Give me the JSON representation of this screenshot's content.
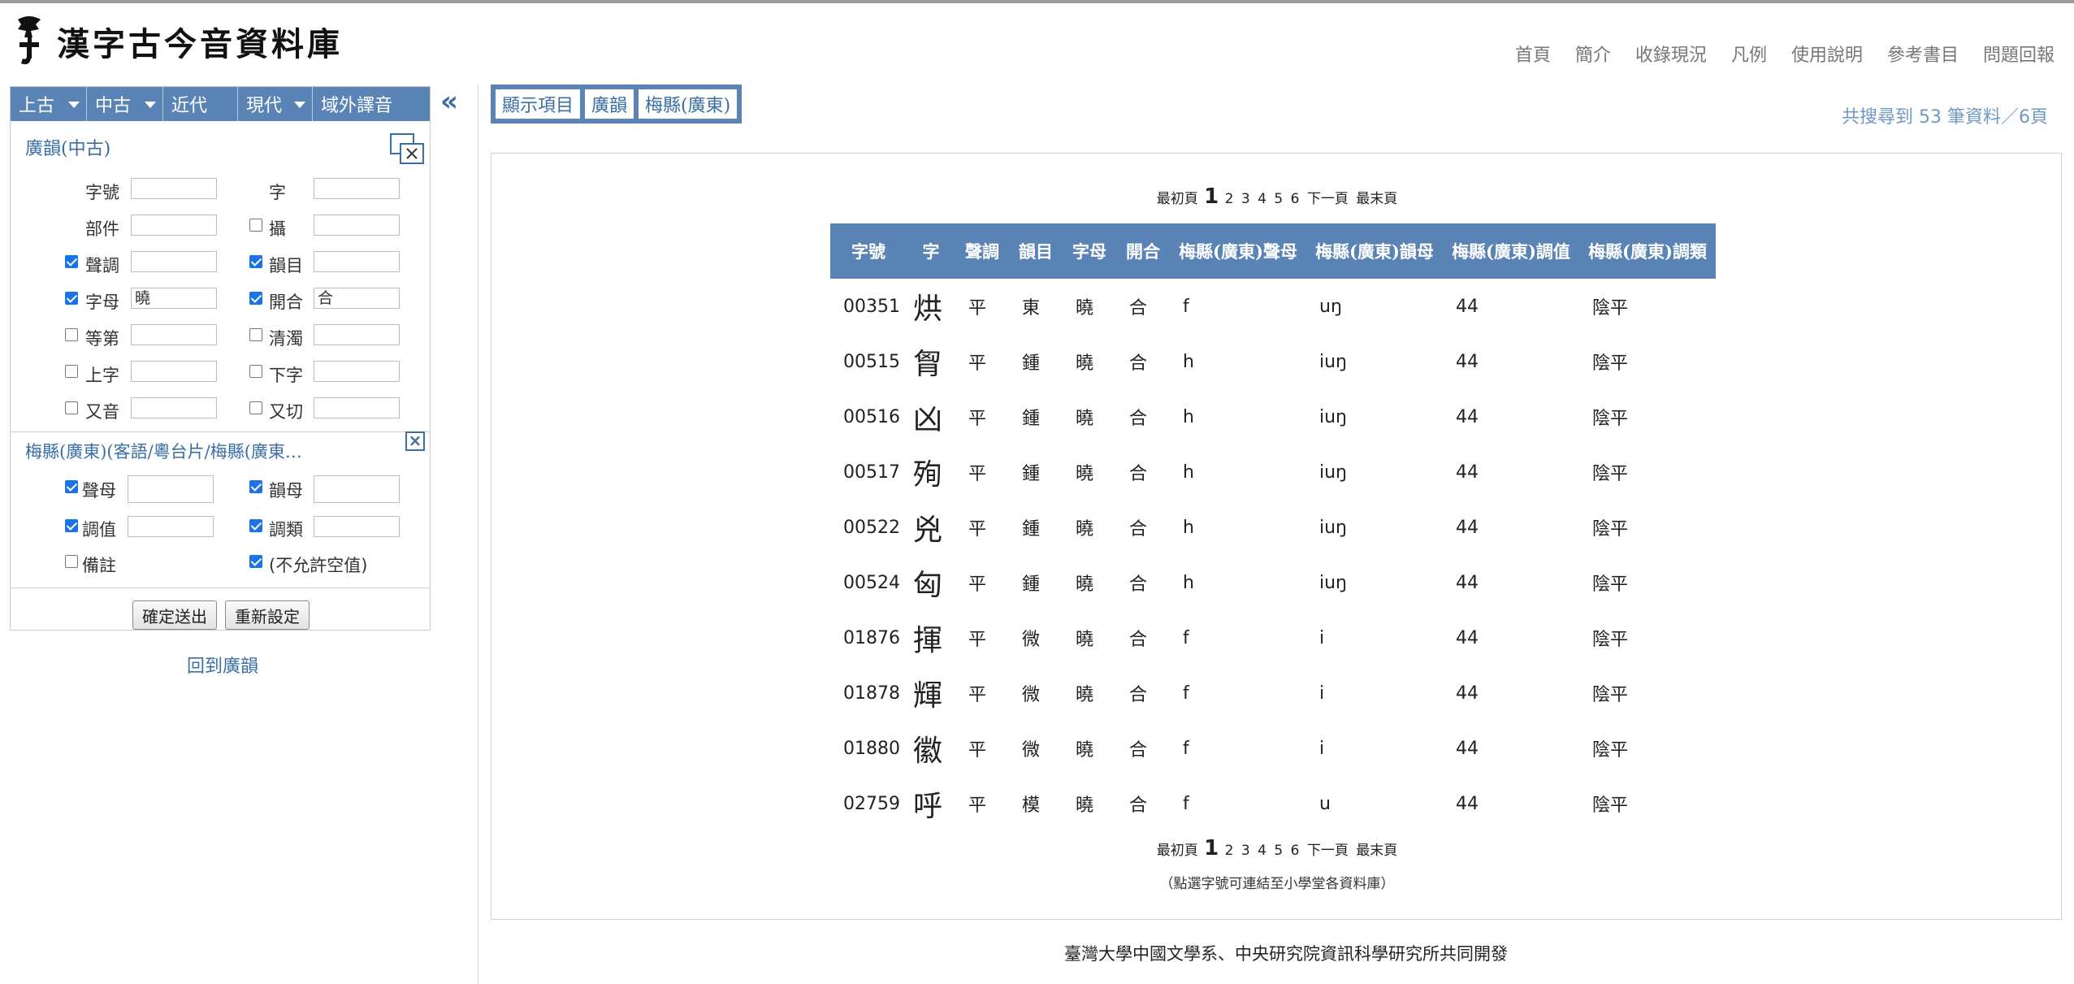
{
  "header": {
    "site_title": "漢字古今音資料庫",
    "nav": [
      "首頁",
      "簡介",
      "收錄現況",
      "凡例",
      "使用說明",
      "參考書目",
      "問題回報"
    ]
  },
  "left_tabs": [
    "上古",
    "中古",
    "近代",
    "現代",
    "域外譯音"
  ],
  "guangyun": {
    "title": "廣韻(中古)",
    "fields": {
      "zihao": {
        "label": "字號",
        "value": ""
      },
      "zi": {
        "label": "字",
        "value": ""
      },
      "bujian": {
        "label": "部件",
        "value": ""
      },
      "she": {
        "label": "攝",
        "value": ""
      },
      "shengdiao": {
        "label": "聲調",
        "value": ""
      },
      "yunmu": {
        "label": "韻目",
        "value": ""
      },
      "zimu": {
        "label": "字母",
        "value": "曉"
      },
      "kaihe": {
        "label": "開合",
        "value": "合"
      },
      "dengdi": {
        "label": "等第",
        "value": ""
      },
      "qingzhuo": {
        "label": "清濁",
        "value": ""
      },
      "shangzi": {
        "label": "上字",
        "value": ""
      },
      "xiazi": {
        "label": "下字",
        "value": ""
      },
      "youyin": {
        "label": "又音",
        "value": ""
      },
      "youqie": {
        "label": "又切",
        "value": ""
      }
    }
  },
  "meixian": {
    "title": "梅縣(廣東)(客語/粵台片/梅縣(廣東…",
    "fields": {
      "shengmu": {
        "label": "聲母",
        "value": ""
      },
      "yunmu": {
        "label": "韻母",
        "value": ""
      },
      "diaozhi": {
        "label": "調值",
        "value": ""
      },
      "diaolei": {
        "label": "調類",
        "value": ""
      },
      "beizhu": {
        "label": "備註"
      },
      "noempty": {
        "label": "(不允許空值)"
      }
    }
  },
  "buttons": {
    "submit": "確定送出",
    "reset": "重新設定"
  },
  "back_link": "回到廣韻",
  "collapse_icon": "«",
  "display_group": [
    "顯示項目",
    "廣韻",
    "梅縣(廣東)"
  ],
  "result_count": "共搜尋到 53 筆資料／6頁",
  "pager": {
    "first": "最初頁",
    "current": "1",
    "pages": [
      "2",
      "3",
      "4",
      "5",
      "6"
    ],
    "next": "下一頁",
    "last": "最末頁"
  },
  "table": {
    "headers": [
      "字號",
      "字",
      "聲調",
      "韻目",
      "字母",
      "開合",
      "梅縣(廣東)聲母",
      "梅縣(廣東)韻母",
      "梅縣(廣東)調值",
      "梅縣(廣東)調類"
    ],
    "rows": [
      [
        "00351",
        "烘",
        "平",
        "東",
        "曉",
        "合",
        "f",
        "uŋ",
        "44",
        "陰平"
      ],
      [
        "00515",
        "胷",
        "平",
        "鍾",
        "曉",
        "合",
        "h",
        "iuŋ",
        "44",
        "陰平"
      ],
      [
        "00516",
        "凶",
        "平",
        "鍾",
        "曉",
        "合",
        "h",
        "iuŋ",
        "44",
        "陰平"
      ],
      [
        "00517",
        "殉",
        "平",
        "鍾",
        "曉",
        "合",
        "h",
        "iuŋ",
        "44",
        "陰平"
      ],
      [
        "00522",
        "兇",
        "平",
        "鍾",
        "曉",
        "合",
        "h",
        "iuŋ",
        "44",
        "陰平"
      ],
      [
        "00524",
        "匈",
        "平",
        "鍾",
        "曉",
        "合",
        "h",
        "iuŋ",
        "44",
        "陰平"
      ],
      [
        "01876",
        "揮",
        "平",
        "微",
        "曉",
        "合",
        "f",
        "i",
        "44",
        "陰平"
      ],
      [
        "01878",
        "輝",
        "平",
        "微",
        "曉",
        "合",
        "f",
        "i",
        "44",
        "陰平"
      ],
      [
        "01880",
        "徽",
        "平",
        "微",
        "曉",
        "合",
        "f",
        "i",
        "44",
        "陰平"
      ],
      [
        "02759",
        "呼",
        "平",
        "模",
        "曉",
        "合",
        "f",
        "u",
        "44",
        "陰平"
      ]
    ]
  },
  "table_note": "（點選字號可連結至小學堂各資料庫）",
  "footer": "臺灣大學中國文學系、中央研究院資訊科學研究所共同開發"
}
